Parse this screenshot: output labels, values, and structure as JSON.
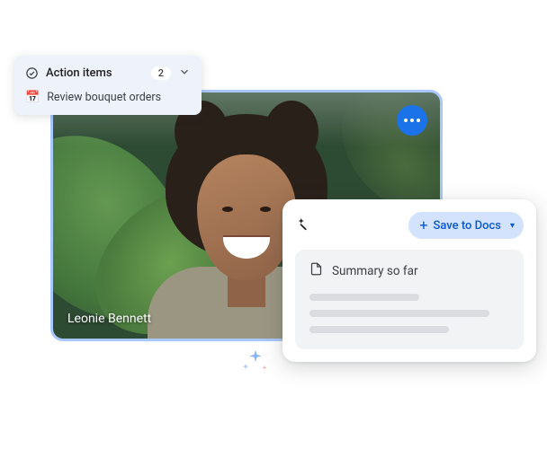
{
  "video": {
    "participant_name": "Leonie Bennett"
  },
  "action_panel": {
    "title": "Action items",
    "count": "2",
    "items": [
      {
        "icon": "calendar",
        "label": "Review bouquet orders"
      }
    ]
  },
  "summary_panel": {
    "save_label": "Save to Docs",
    "title": "Summary so far"
  }
}
